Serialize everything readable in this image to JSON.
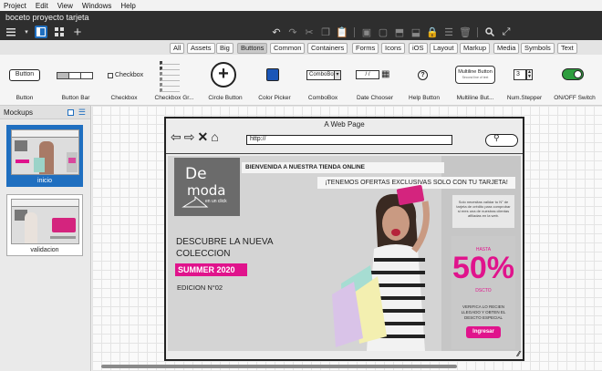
{
  "menubar": {
    "items": [
      "Project",
      "Edit",
      "View",
      "Windows",
      "Help"
    ]
  },
  "window": {
    "title": "boceto proyecto tarjeta"
  },
  "categories": [
    "All",
    "Assets",
    "Big",
    "Buttons",
    "Common",
    "Containers",
    "Forms",
    "Icons",
    "iOS",
    "Layout",
    "Markup",
    "Media",
    "Symbols",
    "Text"
  ],
  "active_category": "Buttons",
  "library": {
    "button_text": "Button",
    "checkbox_text": "Checkbox",
    "combobox_text": "ComboBox",
    "date_text": "/ /",
    "multiline_text": "Multiline Button",
    "multiline_sub": "Second line of text",
    "stepper_value": "3",
    "labels": [
      "Button",
      "Button Bar",
      "Checkbox",
      "Checkbox Gr...",
      "Circle Button",
      "Color Picker",
      "ComboBox",
      "Date Chooser",
      "Help Button",
      "Multiline But...",
      "Num.Stepper",
      "ON/OFF Switch"
    ]
  },
  "panel": {
    "title": "Mockups",
    "mockups": [
      {
        "label": "inicio"
      },
      {
        "label": "validacion"
      }
    ]
  },
  "browser": {
    "title": "A Web Page",
    "url": "http://"
  },
  "page": {
    "logo_de": "De",
    "logo_moda": "moda",
    "logo_sub": "en un click",
    "welcome": "BIENVENIDA A NUESTRA TIENDA ONLINE",
    "offers": "¡TENEMOS OFERTAS EXCLUSIVAS SOLO CON TU TARJETA!",
    "hero_line1": "DESCUBRE LA NUEVA",
    "hero_line2": "COLECCION",
    "summer": "SUMMER 2020",
    "edition": "EDICION N°02",
    "side_info": "Solo necesitas validar tu N° de tarjeta de crédito para comprobar si eres una de nuestras clientas afiliadas en la web.",
    "promo_hasta": "HASTA",
    "promo_pct": "50%",
    "promo_dcto": "DSCTO",
    "promo_text": "VERIFICA LO RECIEN LLEGADO Y OBTEN EL DESCTO ESPECIAL",
    "promo_button": "Ingresar"
  },
  "colors": {
    "brand": "#e0138c",
    "toolbar": "#2e2e2e",
    "selection": "#1f6fc0"
  }
}
